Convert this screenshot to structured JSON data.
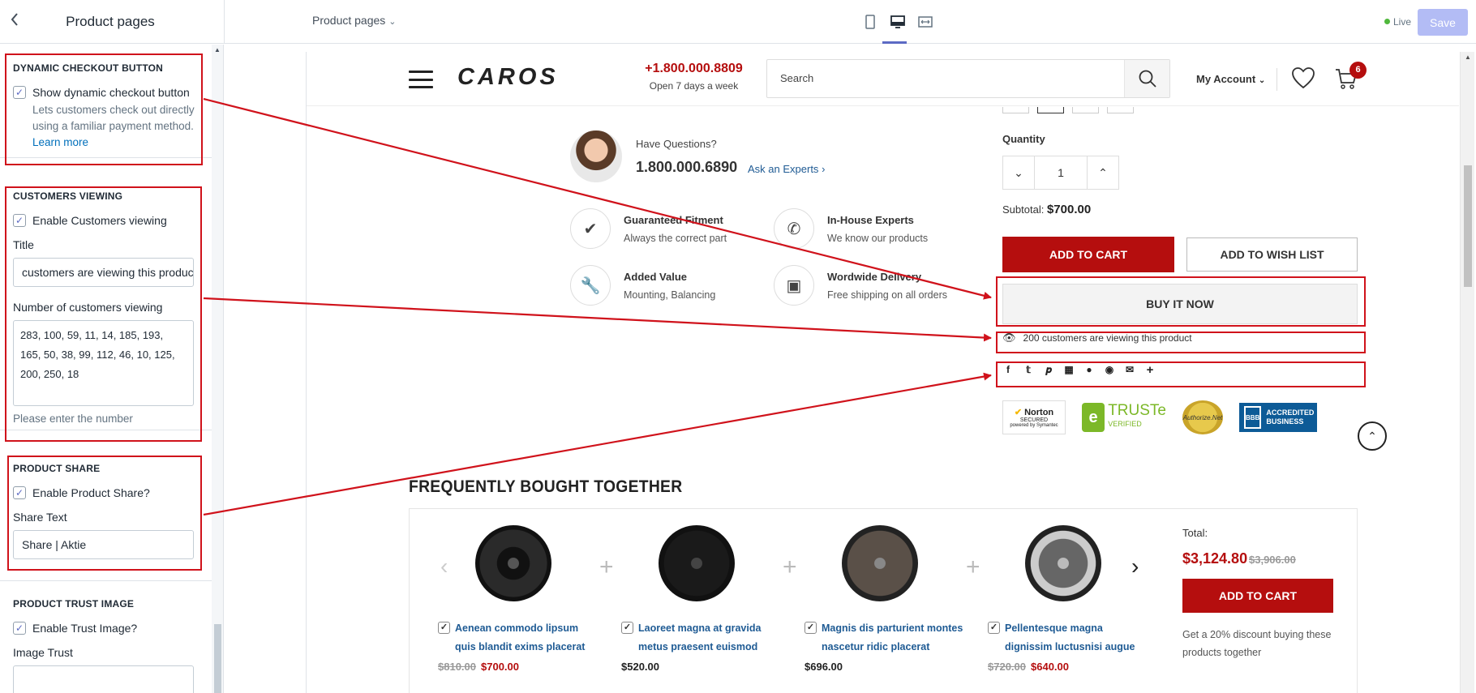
{
  "colors": {
    "accent": "#5c6ac4",
    "brand_red": "#b50e0e",
    "annotation_red": "#d0121b",
    "live_green": "#50b83c"
  },
  "topbar": {
    "back_icon": "chevron-left-icon",
    "panel_title": "Product pages",
    "page_select": "Product pages",
    "view_icons": [
      "mobile-icon",
      "desktop-icon",
      "fullscreen-icon"
    ],
    "active_view": "desktop-icon",
    "live_label": "Live",
    "save_label": "Save"
  },
  "sidebar": {
    "dynamic_checkout": {
      "heading": "DYNAMIC CHECKOUT BUTTON",
      "checkbox_label": "Show dynamic checkout button",
      "checked": true,
      "help": "Lets customers check out directly using a familiar payment method.",
      "help_link": "Learn more"
    },
    "customers_viewing": {
      "heading": "CUSTOMERS VIEWING",
      "checkbox_label": "Enable Customers viewing",
      "checked": true,
      "title_label": "Title",
      "title_value": "customers are viewing this product",
      "number_label": "Number of customers viewing",
      "number_value": "283, 100, 59, 11, 14, 185, 193, 165, 50, 38, 99, 112, 46, 10, 125, 200, 250, 18",
      "number_help": "Please enter the number"
    },
    "product_share": {
      "heading": "PRODUCT SHARE",
      "checkbox_label": "Enable Product Share?",
      "checked": true,
      "share_text_label": "Share Text",
      "share_text_value": "Share | Aktie"
    },
    "trust_image": {
      "heading": "PRODUCT TRUST IMAGE",
      "checkbox_label": "Enable Trust Image?",
      "checked": true,
      "image_label": "Image Trust"
    }
  },
  "site": {
    "logo": "CAROS",
    "phone": "+1.800.000.8809",
    "phone_sub": "Open 7 days a week",
    "search_placeholder": "Search",
    "account_label": "My Account",
    "cart_count": "6"
  },
  "product": {
    "questions_label": "Have Questions?",
    "questions_phone": "1.800.000.6890",
    "ask_experts": "Ask an Experts",
    "features": [
      {
        "icon": "check-icon",
        "title": "Guaranteed Fitment",
        "sub": "Always the correct part"
      },
      {
        "icon": "phone-icon",
        "title": "In-House Experts",
        "sub": "We know our products"
      },
      {
        "icon": "wrench-icon",
        "title": "Added Value",
        "sub": "Mounting, Balancing"
      },
      {
        "icon": "box-icon",
        "title": "Wordwide Delivery",
        "sub": "Free shipping on all orders"
      }
    ],
    "quantity_label": "Quantity",
    "quantity_value": "1",
    "subtotal_label": "Subtotal:",
    "subtotal_value": "$700.00",
    "add_to_cart": "ADD TO CART",
    "add_to_wishlist": "ADD TO WISH LIST",
    "buy_now": "BUY IT NOW",
    "viewing_text": "200 customers are viewing this product",
    "share_icons": [
      "facebook-icon",
      "twitter-icon",
      "pinterest-icon",
      "grid-icon",
      "snapchat-icon",
      "reddit-icon",
      "email-icon",
      "plus-icon"
    ],
    "trust_badges": {
      "norton_1": "Norton",
      "norton_2": "SECURED",
      "norton_3": "powered by Symantec",
      "truste_1": "TRUSTe",
      "truste_2": "VERIFIED",
      "authnet": "Authorize.Net",
      "bbb_1": "ACCREDITED",
      "bbb_2": "BUSINESS"
    }
  },
  "fbt": {
    "title": "FREQUENTLY BOUGHT TOGETHER",
    "items": [
      {
        "name": "Aenean commodo lipsum quis blandit exims placerat",
        "old_price": "$810.00",
        "price": "$700.00"
      },
      {
        "name": "Laoreet magna at gravida metus praesent euismod",
        "old_price": "",
        "price": "$520.00"
      },
      {
        "name": "Magnis dis parturient montes nascetur ridic placerat",
        "old_price": "",
        "price": "$696.00"
      },
      {
        "name": "Pellentesque magna dignissim luctusnisi augue",
        "old_price": "$720.00",
        "price": "$640.00"
      }
    ],
    "total_label": "Total:",
    "total_value": "$3,124.80",
    "total_old": "$3,906.00",
    "add_to_cart": "ADD TO CART",
    "discount_note": "Get a 20% discount buying these products together"
  }
}
